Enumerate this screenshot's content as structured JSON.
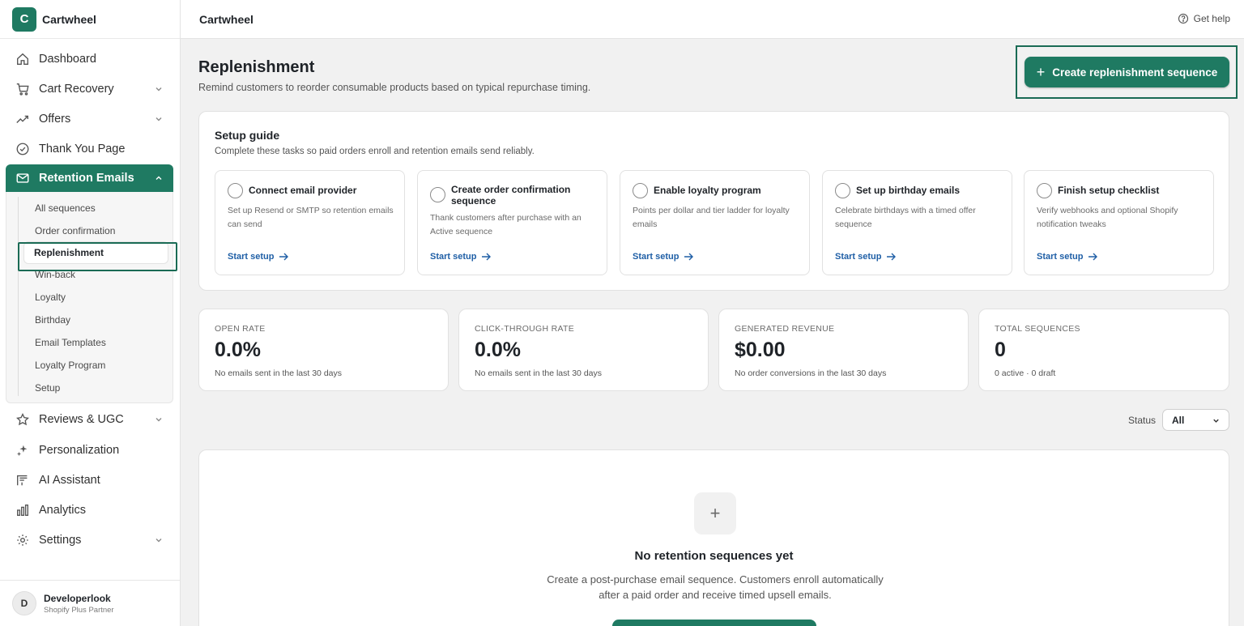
{
  "app": {
    "name": "Cartwheel",
    "logo_letter": "C"
  },
  "sidebar": {
    "items": [
      {
        "label": "Dashboard",
        "icon": "home-icon"
      },
      {
        "label": "Cart Recovery",
        "icon": "cart-icon"
      },
      {
        "label": "Offers",
        "icon": "trend-icon"
      },
      {
        "label": "Thank You Page",
        "icon": "check-circle-icon"
      },
      {
        "label": "Retention Emails",
        "icon": "mail-icon"
      },
      {
        "label": "Reviews & UGC",
        "icon": "star-icon"
      },
      {
        "label": "Personalization",
        "icon": "sparkle-icon"
      },
      {
        "label": "AI Assistant",
        "icon": "ai-icon"
      },
      {
        "label": "Analytics",
        "icon": "bar-chart-icon"
      },
      {
        "label": "Settings",
        "icon": "gear-icon"
      }
    ],
    "subitems": [
      "All sequences",
      "Order confirmation",
      "Replenishment",
      "Win-back",
      "Loyalty",
      "Birthday",
      "Email Templates",
      "Loyalty Program",
      "Setup"
    ],
    "selected_subitem": "Replenishment"
  },
  "user": {
    "initial": "D",
    "name": "Developerlook",
    "role": "Shopify Plus Partner"
  },
  "topbar": {
    "title": "Cartwheel",
    "help": "Get help"
  },
  "page": {
    "title": "Replenishment",
    "subtitle": "Remind customers to reorder consumable products based on typical repurchase timing.",
    "create_button": "Create replenishment sequence"
  },
  "setup_guide": {
    "title": "Setup guide",
    "description": "Complete these tasks so paid orders enroll and retention emails send reliably.",
    "tasks": [
      {
        "title": "Connect email provider",
        "description": "Set up Resend or SMTP so retention emails can send",
        "link": "Start setup"
      },
      {
        "title": "Create order confirmation sequence",
        "description": "Thank customers after purchase with an Active sequence",
        "link": "Start setup"
      },
      {
        "title": "Enable loyalty program",
        "description": "Points per dollar and tier ladder for loyalty emails",
        "link": "Start setup"
      },
      {
        "title": "Set up birthday emails",
        "description": "Celebrate birthdays with a timed offer sequence",
        "link": "Start setup"
      },
      {
        "title": "Finish setup checklist",
        "description": "Verify webhooks and optional Shopify notification tweaks",
        "link": "Start setup"
      }
    ]
  },
  "stats": [
    {
      "label": "OPEN RATE",
      "value": "0.0%",
      "note": "No emails sent in the last 30 days"
    },
    {
      "label": "CLICK-THROUGH RATE",
      "value": "0.0%",
      "note": "No emails sent in the last 30 days"
    },
    {
      "label": "GENERATED REVENUE",
      "value": "$0.00",
      "note": "No order conversions in the last 30 days"
    },
    {
      "label": "TOTAL SEQUENCES",
      "value": "0",
      "note": "0 active · 0 draft"
    }
  ],
  "filter": {
    "label": "Status",
    "value": "All"
  },
  "empty_state": {
    "title": "No retention sequences yet",
    "description": "Create a post-purchase email sequence. Customers enroll automatically after a paid order and receive timed upsell emails."
  },
  "colors": {
    "brand": "#1f7a62",
    "link": "#1f5fa6",
    "highlight": "#1a6b55"
  }
}
